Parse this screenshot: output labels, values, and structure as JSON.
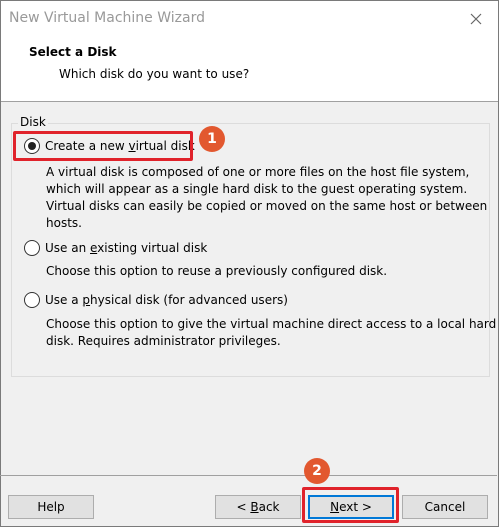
{
  "window": {
    "title": "New Virtual Machine Wizard"
  },
  "header": {
    "title": "Select a Disk",
    "subtitle": "Which disk do you want to use?"
  },
  "group": {
    "legend": "Disk"
  },
  "options": [
    {
      "label_pre": "Create a new ",
      "label_u": "v",
      "label_post": "irtual disk",
      "selected": true,
      "desc": [
        "A virtual disk is composed of one or more files on the host file system,",
        "which will appear as a single hard disk to the guest operating system.",
        "Virtual disks can easily be copied or moved on the same host or between",
        "hosts."
      ]
    },
    {
      "label_pre": "Use an ",
      "label_u": "e",
      "label_post": "xisting virtual disk",
      "selected": false,
      "desc": [
        "Choose this option to reuse a previously configured disk."
      ]
    },
    {
      "label_pre": "Use a ",
      "label_u": "p",
      "label_post": "hysical disk (for advanced users)",
      "selected": false,
      "desc": [
        "Choose this option to give the virtual machine direct access to a local hard",
        "disk. Requires administrator privileges."
      ]
    }
  ],
  "annotations": {
    "badge1": "1",
    "badge2": "2"
  },
  "buttons": {
    "help": "Help",
    "back_pre": "< ",
    "back_u": "B",
    "back_post": "ack",
    "next_u": "N",
    "next_post": "ext >",
    "cancel": "Cancel"
  },
  "colors": {
    "highlight": "#e0232b",
    "badge": "#e2582f",
    "default_button_border": "#0078d7"
  }
}
